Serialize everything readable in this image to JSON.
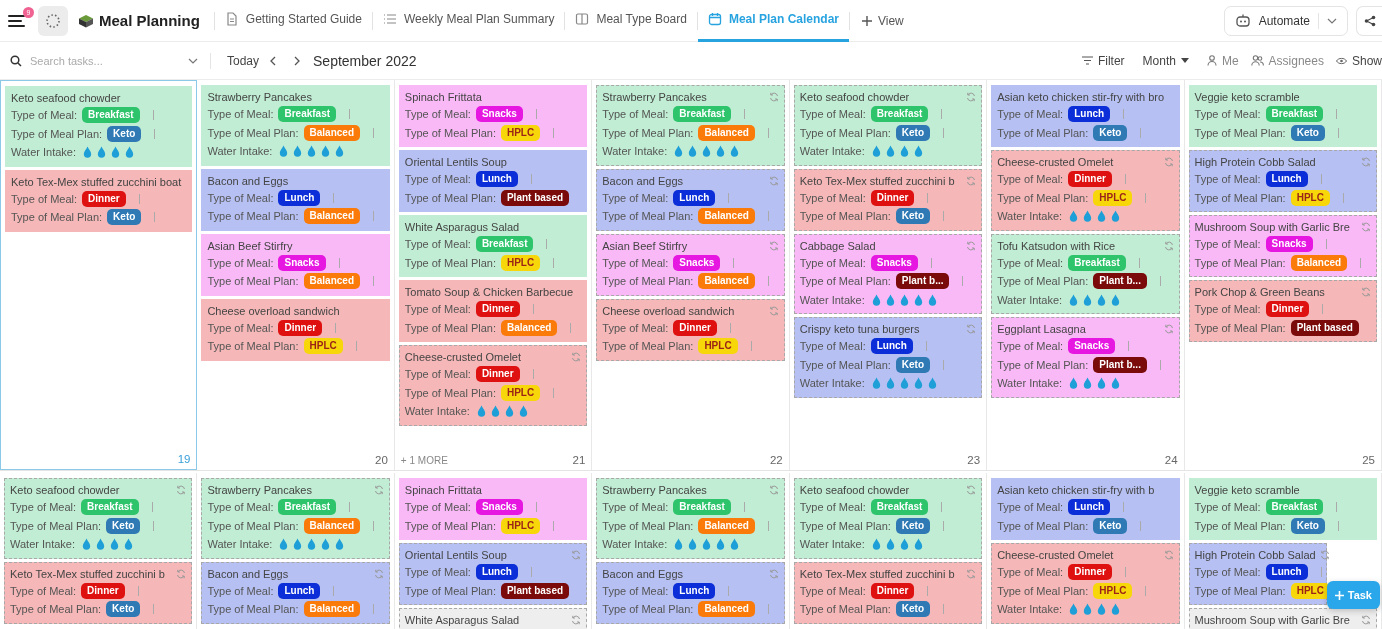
{
  "header": {
    "badge": "9",
    "space": "Meal Planning",
    "tabs": [
      {
        "label": "Getting Started Guide",
        "kind": "doc",
        "selected": false
      },
      {
        "label": "Weekly Meal Plan Summary",
        "kind": "list",
        "selected": false
      },
      {
        "label": "Meal Type Board",
        "kind": "board",
        "selected": false
      },
      {
        "label": "Meal Plan Calendar",
        "kind": "calendar",
        "selected": true
      }
    ],
    "add_view": "View",
    "automate": "Automate"
  },
  "toolbar": {
    "search_placeholder": "Search tasks...",
    "today": "Today",
    "period": "September 2022",
    "filter": "Filter",
    "range": "Month",
    "me": "Me",
    "assignees": "Assignees",
    "show": "Show"
  },
  "weeks": [
    {
      "days": [
        {
          "number": "19",
          "today": true,
          "cards": [
            {
              "title": "Keto seafood chowder",
              "recurring": false,
              "fields": [
                {
                  "kind": "tag",
                  "label": "Type of Meal:",
                  "value": "Breakfast",
                  "color": "#2dc46b"
                },
                {
                  "kind": "tag",
                  "label": "Type of Meal Plan:",
                  "value": "Keto",
                  "color": "#2f7ab5"
                },
                {
                  "kind": "drops",
                  "label": "Water Intake:",
                  "stars": 4
                }
              ]
            },
            {
              "title": "Keto Tex-Mex stuffed zucchini boat",
              "recurring": false,
              "fields": [
                {
                  "kind": "tag",
                  "label": "Type of Meal:",
                  "value": "Dinner",
                  "color": "#df1010"
                },
                {
                  "kind": "tag",
                  "label": "Type of Meal Plan:",
                  "value": "Keto",
                  "color": "#2f7ab5"
                }
              ]
            }
          ]
        },
        {
          "number": "20",
          "today": false,
          "cards": [
            {
              "title": "Strawberry Pancakes",
              "recurring": false,
              "fields": [
                {
                  "kind": "tag",
                  "label": "Type of Meal:",
                  "value": "Breakfast",
                  "color": "#2dc46b"
                },
                {
                  "kind": "tag",
                  "label": "Type of Meal Plan:",
                  "value": "Balanced",
                  "color": "#fa7a0a"
                },
                {
                  "kind": "drops",
                  "label": "Water Intake:",
                  "stars": 5
                }
              ]
            },
            {
              "title": "Bacon and Eggs",
              "recurring": false,
              "fields": [
                {
                  "kind": "tag",
                  "label": "Type of Meal:",
                  "value": "Lunch",
                  "color": "#0b2ed8"
                },
                {
                  "kind": "tag",
                  "label": "Type of Meal Plan:",
                  "value": "Balanced",
                  "color": "#fa7a0a"
                }
              ]
            },
            {
              "title": "Asian Beef Stirfry",
              "recurring": false,
              "fields": [
                {
                  "kind": "tag",
                  "label": "Type of Meal:",
                  "value": "Snacks",
                  "color": "#e617e0"
                },
                {
                  "kind": "tag",
                  "label": "Type of Meal Plan:",
                  "value": "Balanced",
                  "color": "#fa7a0a"
                }
              ]
            },
            {
              "title": "Cheese overload sandwich",
              "recurring": false,
              "fields": [
                {
                  "kind": "tag",
                  "label": "Type of Meal:",
                  "value": "Dinner",
                  "color": "#df1010"
                },
                {
                  "kind": "tag",
                  "label": "Type of Meal Plan:",
                  "value": "HPLC",
                  "color": "#f8d70a"
                }
              ]
            }
          ]
        },
        {
          "number": "21",
          "today": false,
          "more": "+ 1 MORE",
          "cards": [
            {
              "title": "Spinach Frittata",
              "recurring": false,
              "fields": [
                {
                  "kind": "tag",
                  "label": "Type of Meal:",
                  "value": "Snacks",
                  "color": "#e617e0"
                },
                {
                  "kind": "tag",
                  "label": "Type of Meal Plan:",
                  "value": "HPLC",
                  "color": "#f8d70a"
                }
              ]
            },
            {
              "title": "Oriental Lentils Soup",
              "recurring": false,
              "fields": [
                {
                  "kind": "tag",
                  "label": "Type of Meal:",
                  "value": "Lunch",
                  "color": "#0b2ed8"
                },
                {
                  "kind": "tag",
                  "label": "Type of Meal Plan:",
                  "value": "Plant based",
                  "color": "#7b0a0a"
                }
              ]
            },
            {
              "title": "White Asparagus Salad",
              "recurring": false,
              "fields": [
                {
                  "kind": "tag",
                  "label": "Type of Meal:",
                  "value": "Breakfast",
                  "color": "#2dc46b"
                },
                {
                  "kind": "tag",
                  "label": "Type of Meal Plan:",
                  "value": "HPLC",
                  "color": "#f8d70a"
                }
              ]
            },
            {
              "title": "Tomato Soup & Chicken Barbecue",
              "recurring": false,
              "fields": [
                {
                  "kind": "tag",
                  "label": "Type of Meal:",
                  "value": "Dinner",
                  "color": "#df1010"
                },
                {
                  "kind": "tag",
                  "label": "Type of Meal Plan:",
                  "value": "Balanced",
                  "color": "#fa7a0a"
                }
              ]
            },
            {
              "title": "Cheese-crusted Omelet",
              "recurring": true,
              "fields": [
                {
                  "kind": "tag",
                  "label": "Type of Meal:",
                  "value": "Dinner",
                  "color": "#df1010"
                },
                {
                  "kind": "tag",
                  "label": "Type of Meal Plan:",
                  "value": "HPLC",
                  "color": "#f8d70a"
                },
                {
                  "kind": "drops",
                  "label": "Water Intake:",
                  "stars": 4
                }
              ]
            }
          ]
        },
        {
          "number": "22",
          "today": false,
          "cards": [
            {
              "title": "Strawberry Pancakes",
              "recurring": true,
              "fields": [
                {
                  "kind": "tag",
                  "label": "Type of Meal:",
                  "value": "Breakfast",
                  "color": "#2dc46b"
                },
                {
                  "kind": "tag",
                  "label": "Type of Meal Plan:",
                  "value": "Balanced",
                  "color": "#fa7a0a"
                },
                {
                  "kind": "drops",
                  "label": "Water Intake:",
                  "stars": 5
                }
              ]
            },
            {
              "title": "Bacon and Eggs",
              "recurring": true,
              "fields": [
                {
                  "kind": "tag",
                  "label": "Type of Meal:",
                  "value": "Lunch",
                  "color": "#0b2ed8"
                },
                {
                  "kind": "tag",
                  "label": "Type of Meal Plan:",
                  "value": "Balanced",
                  "color": "#fa7a0a"
                }
              ]
            },
            {
              "title": "Asian Beef Stirfry",
              "recurring": true,
              "fields": [
                {
                  "kind": "tag",
                  "label": "Type of Meal:",
                  "value": "Snacks",
                  "color": "#e617e0"
                },
                {
                  "kind": "tag",
                  "label": "Type of Meal Plan:",
                  "value": "Balanced",
                  "color": "#fa7a0a"
                }
              ]
            },
            {
              "title": "Cheese overload sandwich",
              "recurring": true,
              "fields": [
                {
                  "kind": "tag",
                  "label": "Type of Meal:",
                  "value": "Dinner",
                  "color": "#df1010"
                },
                {
                  "kind": "tag",
                  "label": "Type of Meal Plan:",
                  "value": "HPLC",
                  "color": "#f8d70a"
                }
              ]
            }
          ]
        },
        {
          "number": "23",
          "today": false,
          "cards": [
            {
              "title": "Keto seafood chowder",
              "recurring": true,
              "fields": [
                {
                  "kind": "tag",
                  "label": "Type of Meal:",
                  "value": "Breakfast",
                  "color": "#2dc46b"
                },
                {
                  "kind": "tag",
                  "label": "Type of Meal Plan:",
                  "value": "Keto",
                  "color": "#2f7ab5"
                },
                {
                  "kind": "drops",
                  "label": "Water Intake:",
                  "stars": 4
                }
              ]
            },
            {
              "title": "Keto Tex-Mex stuffed zucchini b",
              "recurring": true,
              "fields": [
                {
                  "kind": "tag",
                  "label": "Type of Meal:",
                  "value": "Dinner",
                  "color": "#df1010"
                },
                {
                  "kind": "tag",
                  "label": "Type of Meal Plan:",
                  "value": "Keto",
                  "color": "#2f7ab5"
                }
              ]
            },
            {
              "title": "Cabbage Salad",
              "recurring": true,
              "fields": [
                {
                  "kind": "tag",
                  "label": "Type of Meal:",
                  "value": "Snacks",
                  "color": "#e617e0"
                },
                {
                  "kind": "tag",
                  "label": "Type of Meal Plan:",
                  "value": "Plant b...",
                  "color": "#7b0a0a"
                },
                {
                  "kind": "drops",
                  "label": "Water Intake:",
                  "stars": 5
                }
              ]
            },
            {
              "title": "Crispy keto tuna burgers",
              "recurring": true,
              "fields": [
                {
                  "kind": "tag",
                  "label": "Type of Meal:",
                  "value": "Lunch",
                  "color": "#0b2ed8"
                },
                {
                  "kind": "tag",
                  "label": "Type of Meal Plan:",
                  "value": "Keto",
                  "color": "#2f7ab5"
                },
                {
                  "kind": "drops",
                  "label": "Water Intake:",
                  "stars": 5
                }
              ]
            }
          ]
        },
        {
          "number": "24",
          "today": false,
          "cards": [
            {
              "title": "Asian keto chicken stir-fry with bro",
              "recurring": false,
              "fields": [
                {
                  "kind": "tag",
                  "label": "Type of Meal:",
                  "value": "Lunch",
                  "color": "#0b2ed8"
                },
                {
                  "kind": "tag",
                  "label": "Type of Meal Plan:",
                  "value": "Keto",
                  "color": "#2f7ab5"
                }
              ]
            },
            {
              "title": "Cheese-crusted Omelet",
              "recurring": true,
              "fields": [
                {
                  "kind": "tag",
                  "label": "Type of Meal:",
                  "value": "Dinner",
                  "color": "#df1010"
                },
                {
                  "kind": "tag",
                  "label": "Type of Meal Plan:",
                  "value": "HPLC",
                  "color": "#f8d70a"
                },
                {
                  "kind": "drops",
                  "label": "Water Intake:",
                  "stars": 4
                }
              ]
            },
            {
              "title": "Tofu Katsudon with Rice",
              "recurring": true,
              "fields": [
                {
                  "kind": "tag",
                  "label": "Type of Meal:",
                  "value": "Breakfast",
                  "color": "#2dc46b"
                },
                {
                  "kind": "tag",
                  "label": "Type of Meal Plan:",
                  "value": "Plant b...",
                  "color": "#7b0a0a"
                },
                {
                  "kind": "drops",
                  "label": "Water Intake:",
                  "stars": 4
                }
              ]
            },
            {
              "title": "Eggplant Lasagna",
              "recurring": true,
              "fields": [
                {
                  "kind": "tag",
                  "label": "Type of Meal:",
                  "value": "Snacks",
                  "color": "#e617e0"
                },
                {
                  "kind": "tag",
                  "label": "Type of Meal Plan:",
                  "value": "Plant b...",
                  "color": "#7b0a0a"
                },
                {
                  "kind": "drops",
                  "label": "Water Intake:",
                  "stars": 4
                }
              ]
            }
          ]
        },
        {
          "number": "25",
          "today": false,
          "cards": [
            {
              "title": "Veggie keto scramble",
              "recurring": false,
              "fields": [
                {
                  "kind": "tag",
                  "label": "Type of Meal:",
                  "value": "Breakfast",
                  "color": "#2dc46b"
                },
                {
                  "kind": "tag",
                  "label": "Type of Meal Plan:",
                  "value": "Keto",
                  "color": "#2f7ab5"
                }
              ]
            },
            {
              "title": "High Protein Cobb Salad",
              "recurring": true,
              "fields": [
                {
                  "kind": "tag",
                  "label": "Type of Meal:",
                  "value": "Lunch",
                  "color": "#0b2ed8"
                },
                {
                  "kind": "tag",
                  "label": "Type of Meal Plan:",
                  "value": "HPLC",
                  "color": "#f8d70a"
                }
              ]
            },
            {
              "title": "Mushroom Soup with Garlic Bre",
              "recurring": true,
              "fields": [
                {
                  "kind": "tag",
                  "label": "Type of Meal:",
                  "value": "Snacks",
                  "color": "#e617e0"
                },
                {
                  "kind": "tag",
                  "label": "Type of Meal Plan:",
                  "value": "Balanced",
                  "color": "#fa7a0a"
                }
              ]
            },
            {
              "title": "Pork Chop & Green Beans",
              "recurring": true,
              "fields": [
                {
                  "kind": "tag",
                  "label": "Type of Meal:",
                  "value": "Dinner",
                  "color": "#df1010"
                },
                {
                  "kind": "tag",
                  "label": "Type of Meal Plan:",
                  "value": "Plant based",
                  "color": "#7b0a0a"
                }
              ]
            }
          ]
        }
      ]
    },
    {
      "days": [
        {
          "today": false,
          "cards": [
            {
              "title": "Keto seafood chowder",
              "recurring": true,
              "fields": [
                {
                  "kind": "tag",
                  "label": "Type of Meal:",
                  "value": "Breakfast",
                  "color": "#2dc46b"
                },
                {
                  "kind": "tag",
                  "label": "Type of Meal Plan:",
                  "value": "Keto",
                  "color": "#2f7ab5"
                },
                {
                  "kind": "drops",
                  "label": "Water Intake:",
                  "stars": 4
                }
              ]
            },
            {
              "title": "Keto Tex-Mex stuffed zucchini b",
              "recurring": true,
              "fields": [
                {
                  "kind": "tag",
                  "label": "Type of Meal:",
                  "value": "Dinner",
                  "color": "#df1010"
                },
                {
                  "kind": "tag",
                  "label": "Type of Meal Plan:",
                  "value": "Keto",
                  "color": "#2f7ab5"
                }
              ]
            }
          ]
        },
        {
          "today": false,
          "cards": [
            {
              "title": "Strawberry Pancakes",
              "recurring": true,
              "fields": [
                {
                  "kind": "tag",
                  "label": "Type of Meal:",
                  "value": "Breakfast",
                  "color": "#2dc46b"
                },
                {
                  "kind": "tag",
                  "label": "Type of Meal Plan:",
                  "value": "Balanced",
                  "color": "#fa7a0a"
                },
                {
                  "kind": "drops",
                  "label": "Water Intake:",
                  "stars": 5
                }
              ]
            },
            {
              "title": "Bacon and Eggs",
              "recurring": true,
              "fields": [
                {
                  "kind": "tag",
                  "label": "Type of Meal:",
                  "value": "Lunch",
                  "color": "#0b2ed8"
                },
                {
                  "kind": "tag",
                  "label": "Type of Meal Plan:",
                  "value": "Balanced",
                  "color": "#fa7a0a"
                }
              ]
            }
          ]
        },
        {
          "today": false,
          "cards": [
            {
              "title": "Spinach Frittata",
              "recurring": false,
              "fields": [
                {
                  "kind": "tag",
                  "label": "Type of Meal:",
                  "value": "Snacks",
                  "color": "#e617e0"
                },
                {
                  "kind": "tag",
                  "label": "Type of Meal Plan:",
                  "value": "HPLC",
                  "color": "#f8d70a"
                }
              ]
            },
            {
              "title": "Oriental Lentils Soup",
              "recurring": true,
              "fields": [
                {
                  "kind": "tag",
                  "label": "Type of Meal:",
                  "value": "Lunch",
                  "color": "#0b2ed8"
                },
                {
                  "kind": "tag",
                  "label": "Type of Meal Plan:",
                  "value": "Plant based",
                  "color": "#7b0a0a"
                }
              ]
            },
            {
              "title": "White Asparagus Salad",
              "recurring": true
            }
          ]
        },
        {
          "today": false,
          "cards": [
            {
              "title": "Strawberry Pancakes",
              "recurring": true,
              "fields": [
                {
                  "kind": "tag",
                  "label": "Type of Meal:",
                  "value": "Breakfast",
                  "color": "#2dc46b"
                },
                {
                  "kind": "tag",
                  "label": "Type of Meal Plan:",
                  "value": "Balanced",
                  "color": "#fa7a0a"
                },
                {
                  "kind": "drops",
                  "label": "Water Intake:",
                  "stars": 5
                }
              ]
            },
            {
              "title": "Bacon and Eggs",
              "recurring": true,
              "fields": [
                {
                  "kind": "tag",
                  "label": "Type of Meal:",
                  "value": "Lunch",
                  "color": "#0b2ed8"
                },
                {
                  "kind": "tag",
                  "label": "Type of Meal Plan:",
                  "value": "Balanced",
                  "color": "#fa7a0a"
                }
              ]
            }
          ]
        },
        {
          "today": false,
          "cards": [
            {
              "title": "Keto seafood chowder",
              "recurring": true,
              "fields": [
                {
                  "kind": "tag",
                  "label": "Type of Meal:",
                  "value": "Breakfast",
                  "color": "#2dc46b"
                },
                {
                  "kind": "tag",
                  "label": "Type of Meal Plan:",
                  "value": "Keto",
                  "color": "#2f7ab5"
                },
                {
                  "kind": "drops",
                  "label": "Water Intake:",
                  "stars": 4
                }
              ]
            },
            {
              "title": "Keto Tex-Mex stuffed zucchini b",
              "recurring": true,
              "fields": [
                {
                  "kind": "tag",
                  "label": "Type of Meal:",
                  "value": "Dinner",
                  "color": "#df1010"
                },
                {
                  "kind": "tag",
                  "label": "Type of Meal Plan:",
                  "value": "Keto",
                  "color": "#2f7ab5"
                }
              ]
            }
          ]
        },
        {
          "today": false,
          "cards": [
            {
              "title": "Asian keto chicken stir-fry with b",
              "recurring": false,
              "fields": [
                {
                  "kind": "tag",
                  "label": "Type of Meal:",
                  "value": "Lunch",
                  "color": "#0b2ed8"
                },
                {
                  "kind": "tag",
                  "label": "Type of Meal Plan:",
                  "value": "Keto",
                  "color": "#2f7ab5"
                }
              ]
            },
            {
              "title": "Cheese-crusted Omelet",
              "recurring": true,
              "fields": [
                {
                  "kind": "tag",
                  "label": "Type of Meal:",
                  "value": "Dinner",
                  "color": "#df1010"
                },
                {
                  "kind": "tag",
                  "label": "Type of Meal Plan:",
                  "value": "HPLC",
                  "color": "#f8d70a"
                },
                {
                  "kind": "drops",
                  "label": "Water Intake:",
                  "stars": 4
                }
              ]
            }
          ]
        },
        {
          "today": false,
          "cards": [
            {
              "title": "Veggie keto scramble",
              "recurring": false,
              "fields": [
                {
                  "kind": "tag",
                  "label": "Type of Meal:",
                  "value": "Breakfast",
                  "color": "#2dc46b"
                },
                {
                  "kind": "tag",
                  "label": "Type of Meal Plan:",
                  "value": "Keto",
                  "color": "#2f7ab5"
                }
              ]
            },
            {
              "title": "High Protein Cobb Salad",
              "recurring": true,
              "fields": [
                {
                  "kind": "tag",
                  "label": "Type of Meal:",
                  "value": "Lunch",
                  "color": "#0b2ed8"
                },
                {
                  "kind": "tag",
                  "label": "Type of Meal Plan:",
                  "value": "HPLC",
                  "color": "#f8d70a"
                }
              ]
            },
            {
              "title": "Mushroom Soup with Garlic Bre",
              "recurring": true
            }
          ]
        }
      ]
    }
  ],
  "fab": {
    "label": "Task"
  }
}
